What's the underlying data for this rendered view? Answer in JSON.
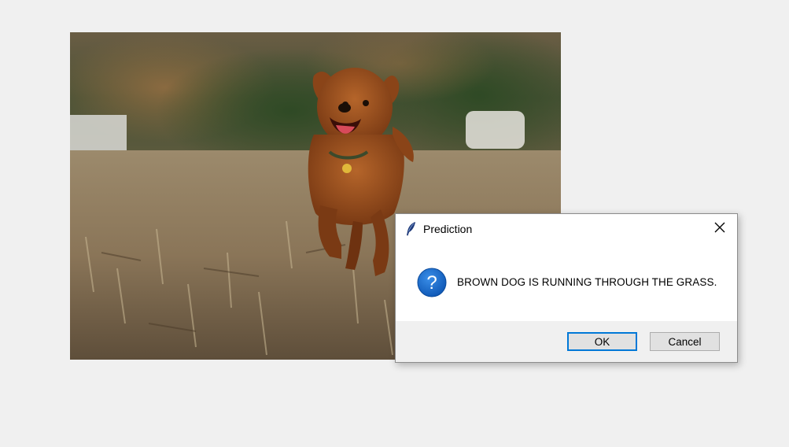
{
  "image": {
    "description_icon": "photo-brown-dog-running-in-field"
  },
  "dialog": {
    "title": "Prediction",
    "title_icon": "feather-icon",
    "message_icon": "question-icon",
    "message": "BROWN DOG IS RUNNING THROUGH THE GRASS.",
    "ok_label": "OK",
    "cancel_label": "Cancel",
    "close_icon": "close-icon"
  },
  "colors": {
    "background": "#f0f0f0",
    "dialog_background": "#ffffff",
    "button_bar": "#f0f0f0",
    "accent": "#0078d7",
    "question_icon": "#1565c0"
  }
}
